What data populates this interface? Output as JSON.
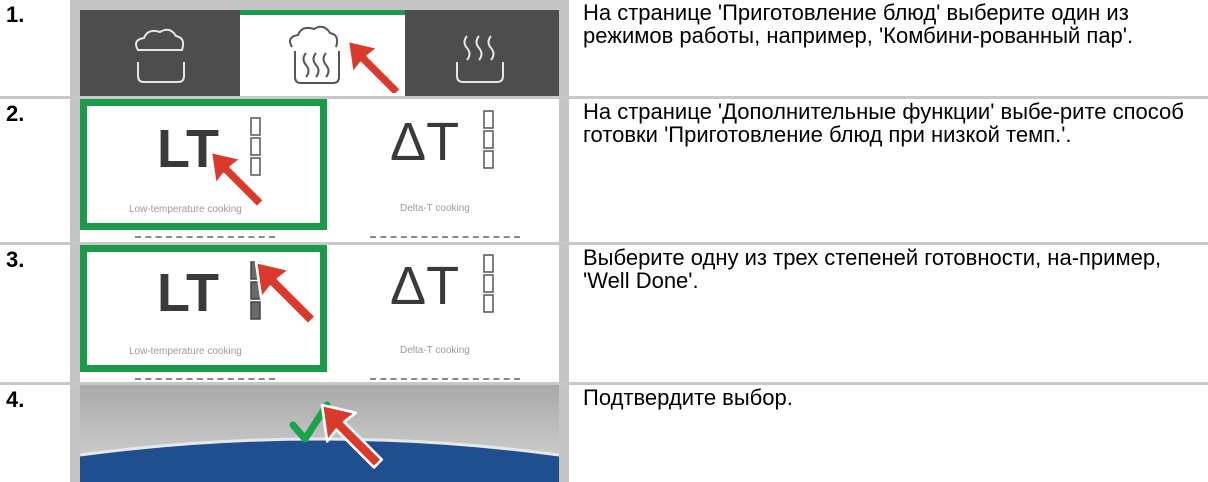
{
  "steps": [
    {
      "number": "1.",
      "text": "На странице 'Приготовление блюд' выберите один из режимов работы, например, 'Комбини-рованный пар'."
    },
    {
      "number": "2.",
      "text": "На странице 'Дополнительные функции' выбе-рите способ готовки 'Приготовление блюд при низкой темп.'.",
      "left_label": "Low-temperature cooking",
      "right_label": "Delta-T cooking",
      "left_glyph": "LT",
      "right_glyph": "ΔT"
    },
    {
      "number": "3.",
      "text": "Выберите одну из трех степеней готовности, на-пример, 'Well Done'.",
      "left_label": "Low-temperature cooking",
      "right_label": "Delta-T cooking",
      "left_glyph": "LT",
      "right_glyph": "ΔT"
    },
    {
      "number": "4.",
      "text": "Подтвердите выбор."
    }
  ],
  "icons": [
    "combi-steam-icon",
    "pointer-arrow-icon",
    "checkmark-icon"
  ],
  "colors": {
    "selection_green": "#1a9a4a",
    "arrow_red": "#d93a2b",
    "dark_tile": "#4d4d4d",
    "check_green": "#1aa34a",
    "blue_band": "#1f4f8f"
  }
}
